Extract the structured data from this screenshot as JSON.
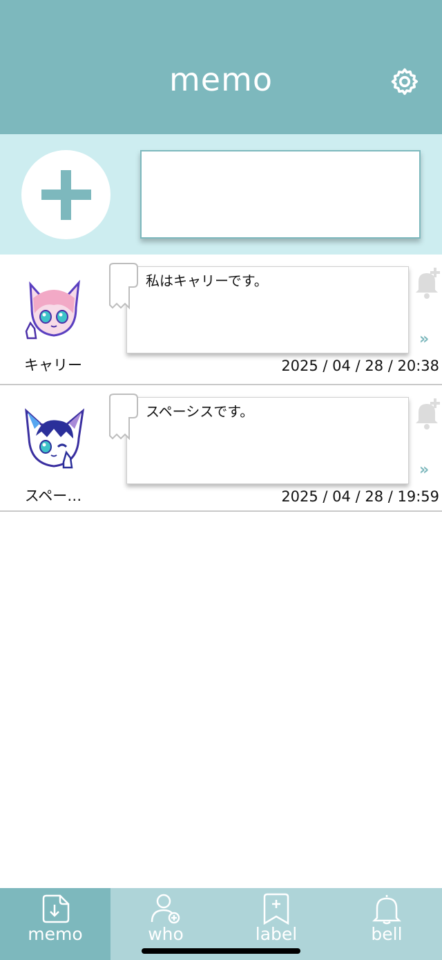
{
  "header": {
    "title": "memo",
    "settings_icon": "gear-icon"
  },
  "compose": {
    "add_icon": "plus-icon",
    "input_value": ""
  },
  "memos": [
    {
      "author": "キャリー",
      "text": "私はキャリーです。",
      "timestamp": "2025 / 04 / 28 / 20:38",
      "more": "»",
      "avatar": "pink-hair-cat-avatar"
    },
    {
      "author": "スペー…",
      "text": "スペーシスです。",
      "timestamp": "2025 / 04 / 28 / 19:59",
      "more": "»",
      "avatar": "blue-hair-cat-avatar"
    }
  ],
  "tabbar": {
    "tabs": [
      {
        "label": "memo",
        "icon": "memo-download-icon",
        "active": true
      },
      {
        "label": "who",
        "icon": "person-add-icon",
        "active": false
      },
      {
        "label": "label",
        "icon": "bookmark-add-icon",
        "active": false
      },
      {
        "label": "bell",
        "icon": "bell-icon",
        "active": false
      }
    ]
  },
  "colors": {
    "accent": "#7db8bd",
    "compose_bg": "#cdedf0",
    "tabbar_bg": "#aed4d8"
  }
}
